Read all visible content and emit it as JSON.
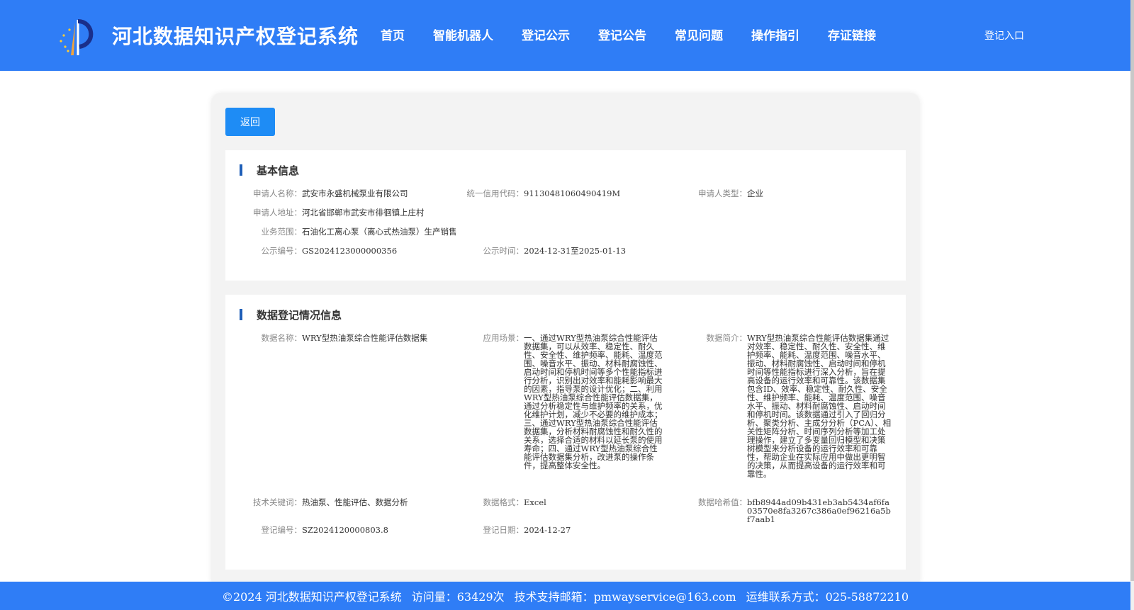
{
  "header": {
    "title": "河北数据知识产权登记系统",
    "nav": [
      "首页",
      "智能机器人",
      "登记公示",
      "登记公告",
      "常见问题",
      "操作指引",
      "存证链接"
    ],
    "login": "登记入口"
  },
  "back_label": "返回",
  "basic": {
    "title": "基本信息",
    "applicant_name": {
      "label": "申请人名称：",
      "value": "武安市永盛机械泵业有限公司"
    },
    "credit_code": {
      "label": "统一信用代码：",
      "value": "91130481060490419M"
    },
    "applicant_type": {
      "label": "申请人类型：",
      "value": "企业"
    },
    "address": {
      "label": "申请人地址：",
      "value": "河北省邯郸市武安市徘徊镇上庄村"
    },
    "scope": {
      "label": "业务范围：",
      "value": "石油化工离心泵（离心式热油泵）生产销售"
    },
    "publicity_no": {
      "label": "公示编号：",
      "value": "GS2024123000000356"
    },
    "publicity_time": {
      "label": "公示时间：",
      "value": "2024-12-31至2025-01-13"
    }
  },
  "registration": {
    "title": "数据登记情况信息",
    "data_name": {
      "label": "数据名称：",
      "value": "WRY型热油泵综合性能评估数据集"
    },
    "scenario": {
      "label": "应用场景：",
      "value": "一、通过WRY型热油泵综合性能评估数据集，可以从效率、稳定性、耐久性、安全性、维护频率、能耗、温度范围、噪音水平、振动、材料耐腐蚀性、启动时间和停机时间等多个性能指标进行分析，识别出对效率和能耗影响最大的因素，指导泵的设计优化；二、利用WRY型热油泵综合性能评估数据集，通过分析稳定性与维护频率的关系，优化维护计划，减少不必要的维护成本；三、通过WRY型热油泵综合性能评估数据集，分析材料耐腐蚀性和耐久性的关系，选择合适的材料以延长泵的使用寿命；四、通过WRY型热油泵综合性能评估数据集分析，改进泵的操作条件，提高整体安全性。"
    },
    "summary": {
      "label": "数据简介：",
      "value": "WRY型热油泵综合性能评估数据集通过对效率、稳定性、耐久性、安全性、维护频率、能耗、温度范围、噪音水平、振动、材料耐腐蚀性、启动时间和停机时间等性能指标进行深入分析，旨在提高设备的运行效率和可靠性。该数据集包含ID、效率、稳定性、耐久性、安全性、维护频率、能耗、温度范围、噪音水平、振动、材料耐腐蚀性、启动时间和停机时间。该数据通过引入了回归分析、聚类分析、主成分分析（PCA）、相关性矩阵分析、时间序列分析等加工处理操作，建立了多变量回归模型和决策树模型来分析设备的运行效率和可靠性，帮助企业在实际应用中做出更明智的决策，从而提高设备的运行效率和可靠性。"
    },
    "keywords": {
      "label": "技术关键词：",
      "value": "热油泵、性能评估、数据分析"
    },
    "format": {
      "label": "数据格式：",
      "value": "Excel"
    },
    "hash": {
      "label": "数据哈希值：",
      "value": "bfb8944ad09b431eb3ab5434af6fa03570e8fa3267c386a0ef96216a5bf7aab1"
    },
    "reg_no": {
      "label": "登记编号：",
      "value": "SZ2024120000803.8"
    },
    "reg_date": {
      "label": "登记日期：",
      "value": "2024-12-27"
    }
  },
  "footer": {
    "copyright": "©2024 河北数据知识产权登记系统",
    "visits": "访问量：63429次",
    "email": "技术支持邮箱：pmwayservice@163.com",
    "phone": "运维联系方式：025-58872210"
  },
  "colors": {
    "header_bg": "#2f7df6",
    "button_bg": "#1e8cf5",
    "section_bar": "#1f5fb8"
  }
}
